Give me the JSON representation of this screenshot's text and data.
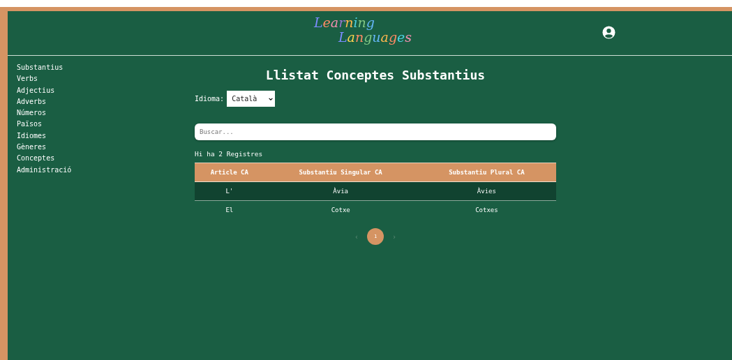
{
  "logo": [
    {
      "letters": [
        {
          "char": "L",
          "color": "#7b8cff"
        },
        {
          "char": "e",
          "color": "#ff8a65"
        },
        {
          "char": "a",
          "color": "#f48fb1"
        },
        {
          "char": "r",
          "color": "#9575cd"
        },
        {
          "char": "n",
          "color": "#ffb74d"
        },
        {
          "char": "i",
          "color": "#4dd0e1"
        },
        {
          "char": "n",
          "color": "#81c784"
        },
        {
          "char": "g",
          "color": "#64b5f6"
        }
      ]
    },
    {
      "letters": [
        {
          "char": "L",
          "color": "#7b8cff"
        },
        {
          "char": "a",
          "color": "#ffd54f"
        },
        {
          "char": "n",
          "color": "#ff8a65"
        },
        {
          "char": "g",
          "color": "#81c784"
        },
        {
          "char": "u",
          "color": "#64b5f6"
        },
        {
          "char": "a",
          "color": "#ffb74d"
        },
        {
          "char": "g",
          "color": "#ff8a65"
        },
        {
          "char": "e",
          "color": "#4dd0e1"
        },
        {
          "char": "s",
          "color": "#f48fb1"
        }
      ]
    }
  ],
  "sidebar": {
    "items": [
      "Substantius",
      "Verbs",
      "Adjectius",
      "Adverbs",
      "Números",
      "Països",
      "Idiomes",
      "Gèneres",
      "Conceptes",
      "Administració"
    ]
  },
  "title": "Llistat Conceptes Substantius",
  "language": {
    "label": "Idioma:",
    "value": "Català"
  },
  "search": {
    "placeholder": "Buscar..."
  },
  "count": "Hi ha 2 Registres",
  "table": {
    "columns": [
      "Article CA",
      "Substantiu Singular CA",
      "Substantiu Plural CA"
    ],
    "rows": [
      {
        "cells": [
          "L'",
          "Àvia",
          "Àvies"
        ],
        "selected": true
      },
      {
        "cells": [
          "El",
          "Cotxe",
          "Cotxes"
        ],
        "selected": false
      }
    ]
  },
  "pagination": {
    "prev": "‹",
    "next": "›",
    "pages": [
      {
        "label": "1",
        "selected": true
      }
    ]
  }
}
